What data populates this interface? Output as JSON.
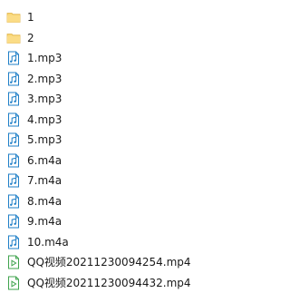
{
  "files": [
    {
      "name": "1",
      "icon": "folder-icon",
      "kind": "folder"
    },
    {
      "name": "2",
      "icon": "folder-icon",
      "kind": "folder"
    },
    {
      "name": "1.mp3",
      "icon": "audio-file-icon",
      "kind": "audio"
    },
    {
      "name": "2.mp3",
      "icon": "audio-file-icon",
      "kind": "audio"
    },
    {
      "name": "3.mp3",
      "icon": "audio-file-icon",
      "kind": "audio"
    },
    {
      "name": "4.mp3",
      "icon": "audio-file-icon",
      "kind": "audio"
    },
    {
      "name": "5.mp3",
      "icon": "audio-file-icon",
      "kind": "audio"
    },
    {
      "name": "6.m4a",
      "icon": "audio-file-icon",
      "kind": "audio"
    },
    {
      "name": "7.m4a",
      "icon": "audio-file-icon",
      "kind": "audio"
    },
    {
      "name": "8.m4a",
      "icon": "audio-file-icon",
      "kind": "audio"
    },
    {
      "name": "9.m4a",
      "icon": "audio-file-icon",
      "kind": "audio"
    },
    {
      "name": "10.m4a",
      "icon": "audio-file-icon",
      "kind": "audio"
    },
    {
      "name": "QQ视频20211230094254.mp4",
      "icon": "video-file-icon",
      "kind": "video"
    },
    {
      "name": "QQ视频20211230094432.mp4",
      "icon": "video-file-icon",
      "kind": "video"
    }
  ],
  "colors": {
    "folder": "#F8D775",
    "folder_dark": "#E8B84A",
    "audio_accent": "#1F7FC7",
    "video_accent": "#3FA34D"
  }
}
